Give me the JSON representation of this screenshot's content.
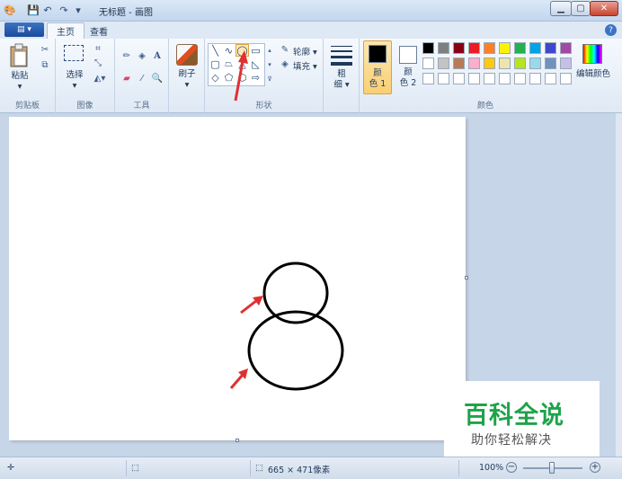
{
  "titlebar": {
    "title": "无标题 - 画图",
    "icons": [
      "paint-app-icon",
      "save-icon",
      "undo-icon",
      "redo-icon",
      "customize-dropdown-icon"
    ],
    "window_buttons": [
      "minimize",
      "maximize",
      "close"
    ]
  },
  "tabs": {
    "file_label": "▤ ▾",
    "home_label": "主页",
    "view_label": "查看",
    "help_label": "?"
  },
  "ribbon": {
    "clipboard": {
      "paste_label": "粘贴",
      "group_label": "剪贴板"
    },
    "image": {
      "select_label": "选择",
      "group_label": "图像"
    },
    "tools": {
      "group_label": "工具"
    },
    "brushes": {
      "label": "刷子"
    },
    "shapes": {
      "outline_label": "轮廓 ▾",
      "fill_label": "填充 ▾",
      "group_label": "形状",
      "selected_shape": "oval"
    },
    "size": {
      "label1": "粗",
      "label2": "细 ▾"
    },
    "colors": {
      "color1_label1": "颜",
      "color1_label2": "色 1",
      "color2_label1": "颜",
      "color2_label2": "色 2",
      "edit_label": "编辑颜色",
      "group_label": "颜色",
      "color1_value": "#000000",
      "color2_value": "#ffffff",
      "palette_row1": [
        "#000000",
        "#7f7f7f",
        "#880015",
        "#ed1c24",
        "#ff7f27",
        "#fff200",
        "#22b14c",
        "#00a2e8",
        "#3f48cc",
        "#a349a4"
      ],
      "palette_row2": [
        "#ffffff",
        "#c3c3c3",
        "#b97a57",
        "#ffaec9",
        "#ffc90e",
        "#efe4b0",
        "#b5e61d",
        "#99d9ea",
        "#7092be",
        "#c8bfe7"
      ],
      "palette_row3": [
        "#ffffff",
        "#ffffff",
        "#ffffff",
        "#ffffff",
        "#ffffff",
        "#ffffff",
        "#ffffff",
        "#ffffff",
        "#ffffff",
        "#ffffff"
      ]
    }
  },
  "watermark": {
    "title": "百科全说",
    "subtitle": "助你轻松解决"
  },
  "statusbar": {
    "canvas_size": "665 × 471像素",
    "zoom": "100%"
  }
}
